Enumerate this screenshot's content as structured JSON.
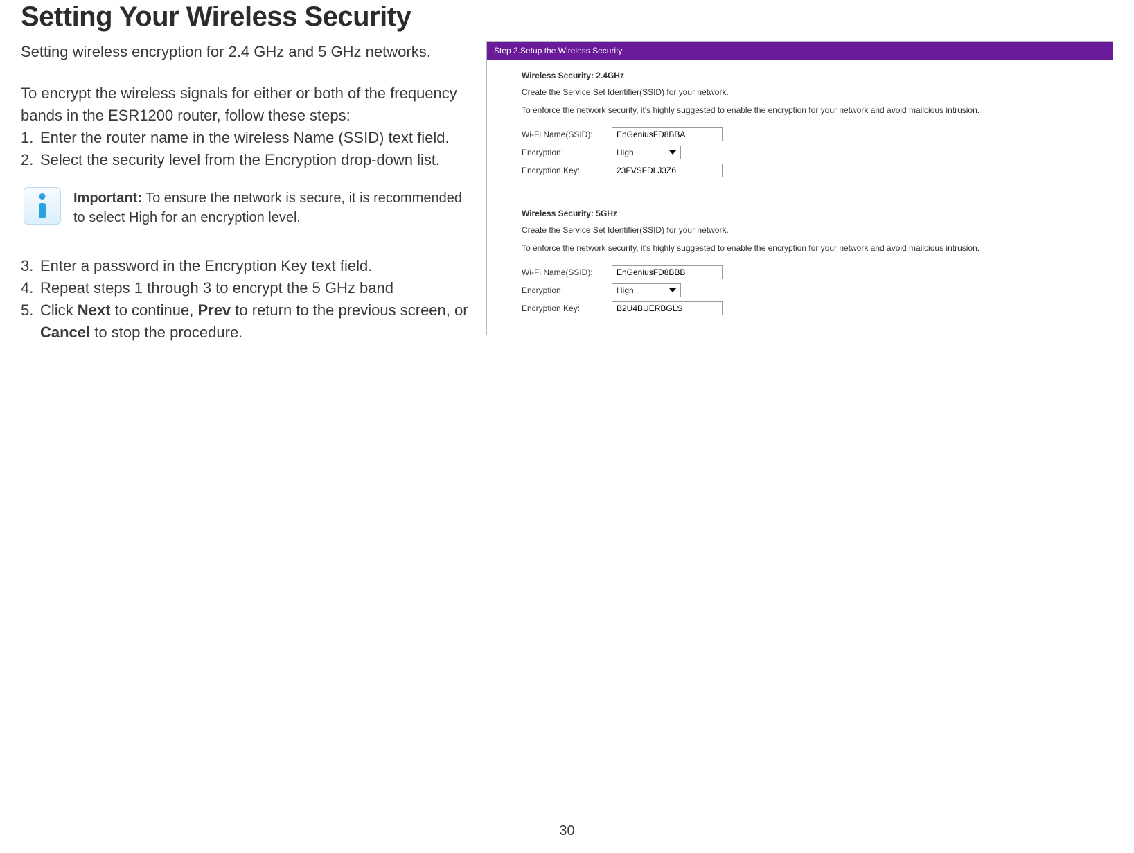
{
  "page": {
    "title": "Setting Your Wireless Security",
    "subtitle": "Setting wireless encryption for 2.4 GHz and 5 GHz networks.",
    "intro": "To encrypt the wireless signals for either or both of the frequency bands in the ESR1200 router, follow these steps:",
    "number": "30"
  },
  "steps_a": [
    {
      "n": "1.",
      "t": "Enter the router name in the wireless Name (SSID) text field."
    },
    {
      "n": "2.",
      "t": "Select the security level from the Encryption drop-down list."
    }
  ],
  "important": {
    "label": "Important:",
    "text": " To ensure the network is secure, it is recommended to select High for an encryption level."
  },
  "steps_b": {
    "s3": {
      "n": "3.",
      "t": "Enter a password in the Encryption Key text field."
    },
    "s4": {
      "n": "4.",
      "t": "Repeat steps 1 through 3 to encrypt the 5 GHz band"
    },
    "s5": {
      "n": "5.",
      "pre": "Click ",
      "b1": "Next",
      "mid1": " to continue, ",
      "b2": "Prev",
      "mid2": " to return to the previous screen, or ",
      "b3": "Cancel",
      "post": " to stop the procedure."
    }
  },
  "wizard": {
    "header": "Step 2.Setup the Wireless Security",
    "labels": {
      "ssid": "Wi-Fi Name(SSID):",
      "enc": "Encryption:",
      "key": "Encryption Key:"
    },
    "desc1": "Create the Service Set Identifier(SSID) for your network.",
    "desc2": "To enforce the network security, it's highly suggested to enable the encryption for your network and avoid mailcious intrusion.",
    "band24": {
      "title": "Wireless Security: 2.4GHz",
      "ssid": "EnGeniusFD8BBA",
      "encryption": "High",
      "key": "23FVSFDLJ3Z6"
    },
    "band5": {
      "title": "Wireless Security: 5GHz",
      "ssid": "EnGeniusFD8BBB",
      "encryption": "High",
      "key": "B2U4BUERBGLS"
    }
  }
}
